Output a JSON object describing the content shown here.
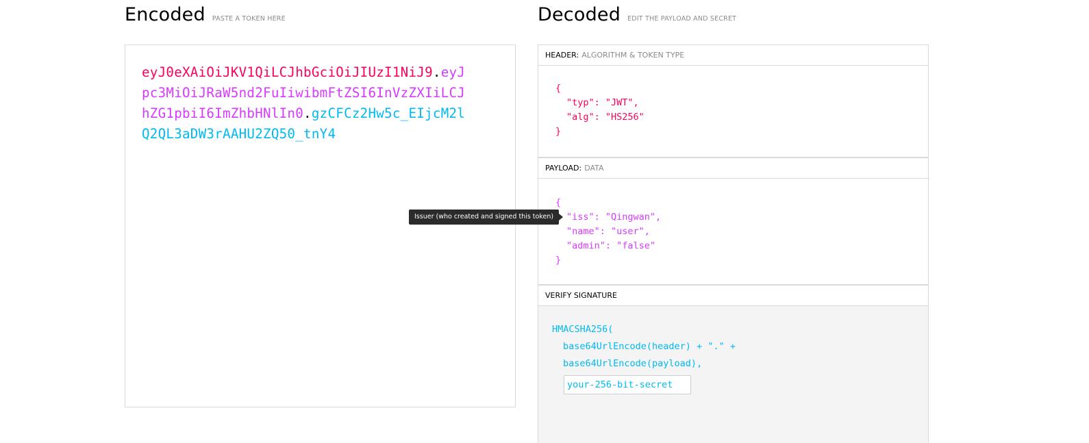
{
  "encoded": {
    "title": "Encoded",
    "subtitle": "PASTE A TOKEN HERE",
    "token": {
      "header": "eyJ0eXAiOiJKV1QiLCJhbGciOiJIUzI1NiJ9",
      "dot1": ".",
      "payload": "eyJpc3MiOiJRaW5nd2FuIiwibmFtZSI6InVzZXIiLCJhZG1pbiI6ImZhbHNlIn0",
      "dot2": ".",
      "signature": "gzCFCz2Hw5c_EIjcM2lQ2QL3aDW3rAAHU2ZQ50_tnY4"
    }
  },
  "decoded": {
    "title": "Decoded",
    "subtitle": "EDIT THE PAYLOAD AND SECRET",
    "header": {
      "label": "HEADER:",
      "sub": "ALGORITHM & TOKEN TYPE",
      "lines": [
        "{",
        "\"typ\": \"JWT\",",
        "\"alg\": \"HS256\"",
        "}"
      ]
    },
    "payload": {
      "label": "PAYLOAD:",
      "sub": "DATA",
      "lines": [
        "{",
        "\"iss\": \"Qingwan\",",
        "\"name\": \"user\",",
        "\"admin\": \"false\"",
        "}"
      ]
    },
    "signature": {
      "label": "VERIFY SIGNATURE",
      "lines": [
        "HMACSHA256(",
        "base64UrlEncode(header) + \".\" +",
        "base64UrlEncode(payload),"
      ],
      "secret_placeholder": "your-256-bit-secret"
    }
  },
  "tooltip": {
    "text": "Issuer (who created and signed this token)"
  },
  "colors": {
    "header": "#fb015b",
    "payload": "#d63aff",
    "signature": "#00b9f1"
  }
}
